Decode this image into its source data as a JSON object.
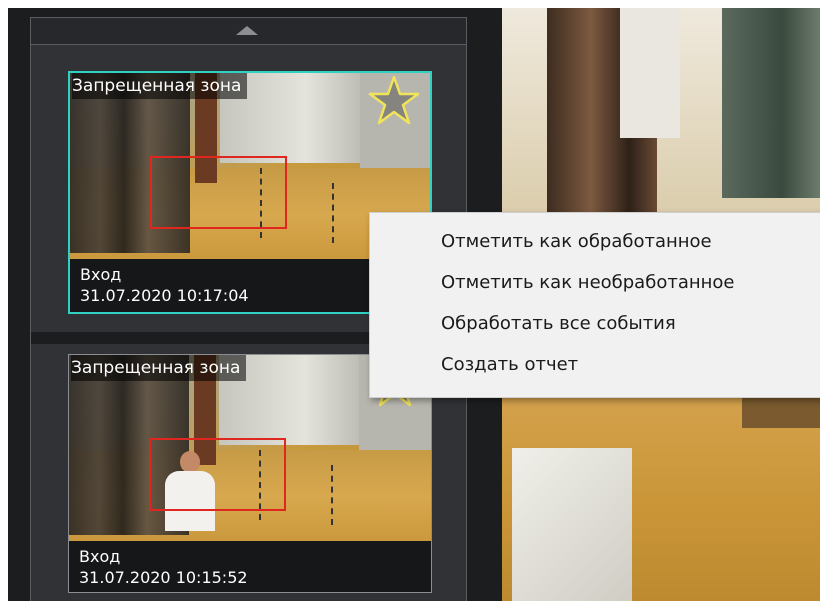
{
  "events": [
    {
      "title": "Запрещенная зона",
      "camera": "Вход",
      "timestamp": "31.07.2020 10:17:04",
      "selected": true
    },
    {
      "title": "Запрещенная зона",
      "camera": "Вход",
      "timestamp": "31.07.2020 10:15:52",
      "selected": false
    }
  ],
  "context_menu": {
    "items": [
      "Отметить как обработанное",
      "Отметить как необработанное",
      "Обработать все события",
      "Создать отчет"
    ]
  },
  "icons": {
    "scroll_up": "triangle-up-icon",
    "favorite": "star-outline-icon"
  },
  "colors": {
    "selected_border": "#2fd1c2",
    "zone_outline": "#e0271f",
    "star_outline": "#f1e35a"
  }
}
